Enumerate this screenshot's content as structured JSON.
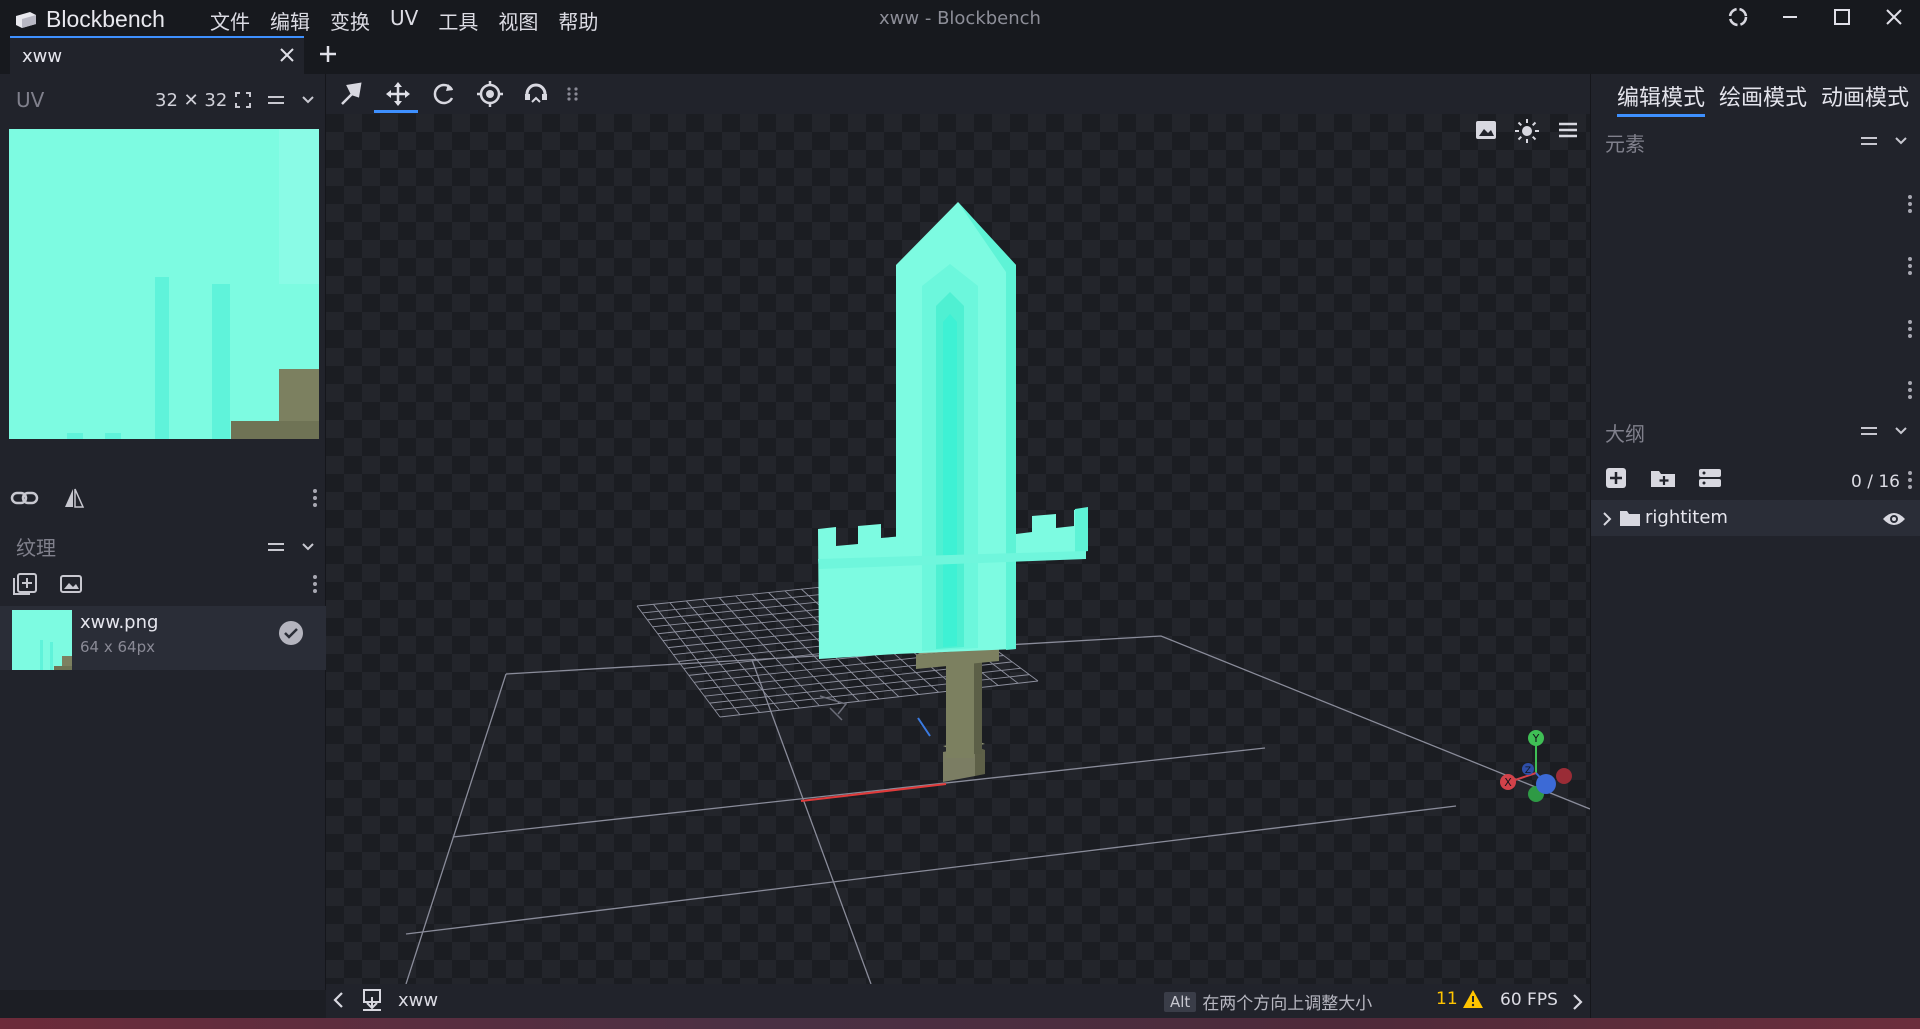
{
  "app": {
    "name": "Blockbench",
    "window_title": "xww - Blockbench",
    "menu": [
      "文件",
      "编辑",
      "变换",
      "UV",
      "工具",
      "视图",
      "帮助"
    ]
  },
  "tabs": [
    {
      "label": "xww",
      "active": true
    }
  ],
  "uv_panel": {
    "title": "UV",
    "size": "32 ✕ 32"
  },
  "textures_panel": {
    "title": "纹理",
    "items": [
      {
        "name": "xww.png",
        "dims": "64 x 64px",
        "selected": true
      }
    ]
  },
  "toolbar": {
    "tools": [
      "pivot-tool",
      "move-tool",
      "rotate-tool",
      "resize-tool",
      "vertex-snap-tool"
    ],
    "active_tool": "move-tool"
  },
  "modes": {
    "items": [
      "编辑模式",
      "绘画模式",
      "动画模式"
    ],
    "active": "编辑模式"
  },
  "elements_panel": {
    "title": "元素"
  },
  "outliner": {
    "title": "大纲",
    "count": "0 / 16",
    "items": [
      {
        "name": "rightitem",
        "type": "group",
        "visible": true
      }
    ]
  },
  "gizmo_axes": {
    "x": "X",
    "y": "Y",
    "z": "Z"
  },
  "status": {
    "project": "xww",
    "hint_key": "Alt",
    "hint_text": "在两个方向上调整大小",
    "warning_count": "11",
    "fps": "60 FPS"
  },
  "colors": {
    "accent": "#3e90ff",
    "blade": "#7dfbe1",
    "blade_core": "#3ef1d4",
    "handle": "#7c8060",
    "warning": "#ffc400"
  }
}
